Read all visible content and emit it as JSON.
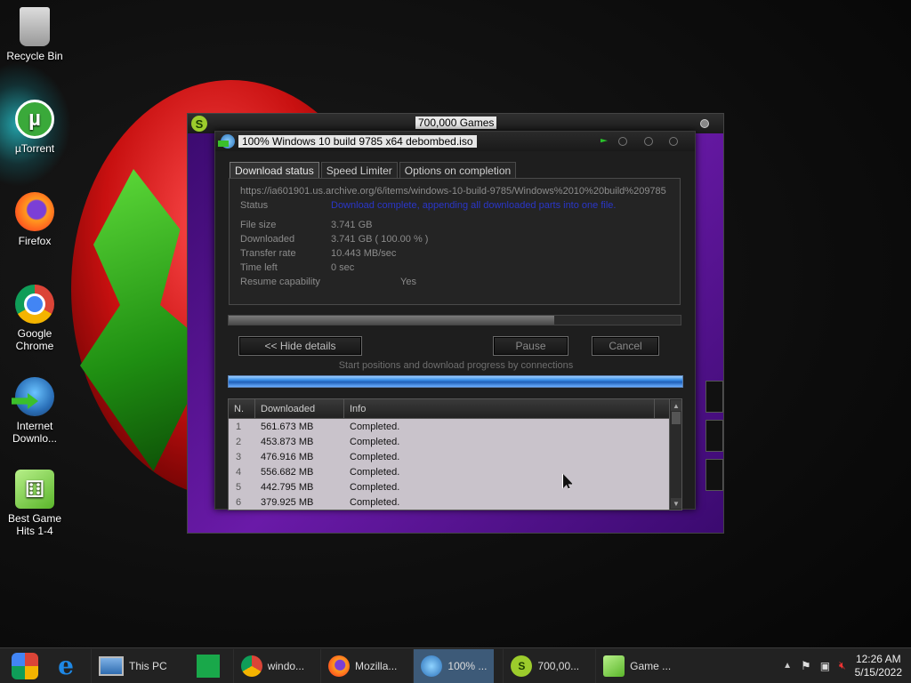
{
  "desktop": {
    "icons": [
      {
        "label": "Recycle Bin",
        "icon": "recycle-bin-icon"
      },
      {
        "label": "µTorrent",
        "icon": "utorrent-icon"
      },
      {
        "label": "Firefox",
        "icon": "firefox-icon"
      },
      {
        "label": "Google Chrome",
        "icon": "chrome-icon"
      },
      {
        "label": "Internet Downlo...",
        "icon": "idm-icon"
      },
      {
        "label": "Best Game Hits 1-4",
        "icon": "dice-icon"
      }
    ]
  },
  "outer_window": {
    "title": "700,000 Games",
    "logo": "S"
  },
  "download_window": {
    "title": "100% Windows 10 build 9785 x64 debombed.iso",
    "tabs": [
      "Download status",
      "Speed Limiter",
      "Options on completion"
    ],
    "url": "https://ia601901.us.archive.org/6/items/windows-10-build-9785/Windows%2010%20build%209785",
    "status_label": "Status",
    "status_value": "Download complete, appending all downloaded parts into one file.",
    "file_size_label": "File size",
    "file_size_value": "3.741  GB",
    "downloaded_label": "Downloaded",
    "downloaded_value": "3.741  GB  ( 100.00 % )",
    "transfer_rate_label": "Transfer rate",
    "transfer_rate_value": "10.443  MB/sec",
    "time_left_label": "Time left",
    "time_left_value": "0 sec",
    "resume_label": "Resume capability",
    "resume_value": "Yes",
    "progress_fraction": 0.72,
    "hide_details_label": "<< Hide details",
    "pause_label": "Pause",
    "cancel_label": "Cancel",
    "connections_label": "Start positions and download progress by connections",
    "table": {
      "headers": [
        "N.",
        "Downloaded",
        "Info"
      ],
      "rows": [
        {
          "n": "1",
          "downloaded": "561.673  MB",
          "info": "Completed."
        },
        {
          "n": "2",
          "downloaded": "453.873  MB",
          "info": "Completed."
        },
        {
          "n": "3",
          "downloaded": "476.916  MB",
          "info": "Completed."
        },
        {
          "n": "4",
          "downloaded": "556.682  MB",
          "info": "Completed."
        },
        {
          "n": "5",
          "downloaded": "442.795  MB",
          "info": "Completed."
        },
        {
          "n": "6",
          "downloaded": "379.925  MB",
          "info": "Completed."
        }
      ]
    }
  },
  "taskbar": {
    "buttons": [
      {
        "label": "This PC",
        "icon": "this-pc-icon"
      },
      {
        "label": "windo...",
        "icon": "chrome-icon"
      },
      {
        "label": "Mozilla...",
        "icon": "firefox-icon"
      },
      {
        "label": "100% ...",
        "icon": "idm-icon",
        "active": true
      },
      {
        "label": "700,00...",
        "icon": "games-icon"
      },
      {
        "label": "Game ...",
        "icon": "dice-icon"
      }
    ],
    "clock_time": "12:26 AM",
    "clock_date": "5/15/2022"
  }
}
